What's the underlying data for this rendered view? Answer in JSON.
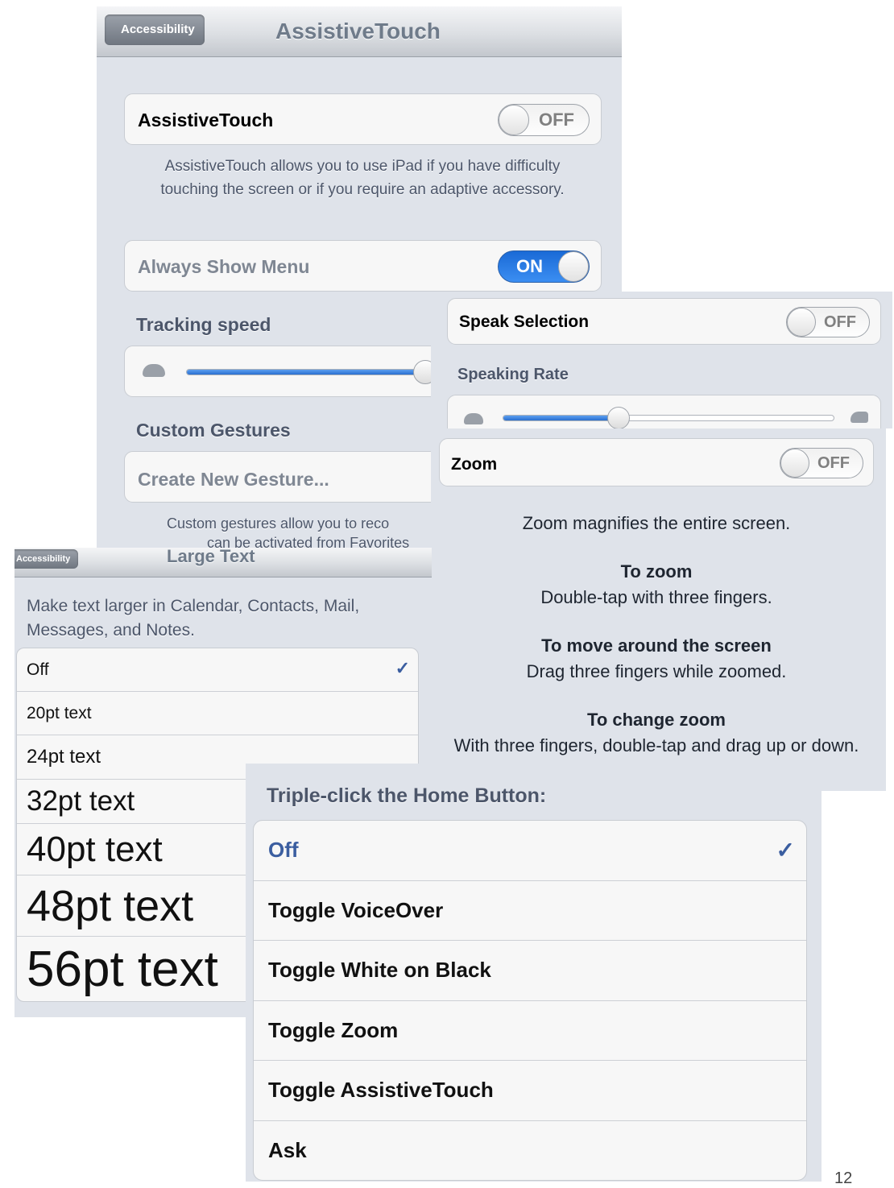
{
  "assistive": {
    "back_label": "Accessibility",
    "title": "AssistiveTouch",
    "toggle_label": "AssistiveTouch",
    "toggle_state": "OFF",
    "description": "AssistiveTouch allows you to use iPad if you have difficulty touching the screen or if you require an adaptive accessory.",
    "always_show_label": "Always Show Menu",
    "always_show_state": "ON",
    "tracking_header": "Tracking speed",
    "tracking_level": 0.69,
    "gestures_header": "Custom Gestures",
    "create_gesture": "Create New Gesture...",
    "gestures_footnote": "Custom gestures allow you to reco",
    "gestures_footnote2": "can be activated from Favorites"
  },
  "speak": {
    "label": "Speak Selection",
    "state": "OFF",
    "rate_header": "Speaking Rate",
    "rate_level": 0.35
  },
  "zoom": {
    "label": "Zoom",
    "state": "OFF",
    "intro": "Zoom magnifies the entire screen.",
    "h1": "To zoom",
    "t1": "Double-tap with three fingers.",
    "h2": "To move around the screen",
    "t2": "Drag three fingers while zoomed.",
    "h3": "To change zoom",
    "t3": "With three fingers, double-tap and drag up or down."
  },
  "large_text": {
    "back_label": "Accessibility",
    "title": "Large Text",
    "description": "Make text larger in Calendar, Contacts, Mail, Messages, and Notes.",
    "options": [
      "Off",
      "20pt text",
      "24pt text",
      "32pt text",
      "40pt text",
      "48pt text",
      "56pt text"
    ],
    "selected": "Off"
  },
  "triple_click": {
    "header": "Triple-click the Home Button:",
    "options": [
      "Off",
      "Toggle VoiceOver",
      "Toggle White on Black",
      "Toggle Zoom",
      "Toggle AssistiveTouch",
      "Ask"
    ],
    "selected": "Off"
  },
  "check_glyph": "✓",
  "page_number": "12",
  "colors": {
    "switch_on": "#2a7be4",
    "selected_text": "#3b5ea0",
    "section_text": "#4c566a"
  }
}
